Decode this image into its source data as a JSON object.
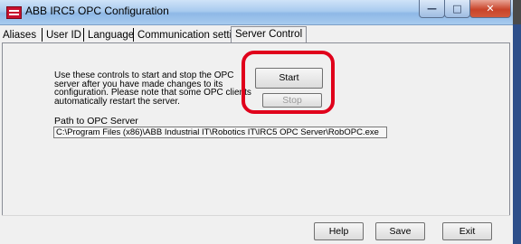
{
  "window": {
    "title": "ABB IRC5 OPC Configuration"
  },
  "tabs": [
    {
      "label": "Aliases"
    },
    {
      "label": "User ID"
    },
    {
      "label": "Language"
    },
    {
      "label": "Communication settings"
    },
    {
      "label": "Server Control",
      "selected": true
    }
  ],
  "server_control": {
    "description": "Use these controls to start and stop the OPC server after you have made changes to its configuration. Please note that some OPC clients automatically restart the server.",
    "start_label": "Start",
    "stop_label": "Stop",
    "path_label": "Path to OPC Server",
    "path_value": "C:\\Program Files (x86)\\ABB Industrial IT\\Robotics IT\\IRC5 OPC Server\\RobOPC.exe"
  },
  "footer": {
    "help_label": "Help",
    "save_label": "Save",
    "exit_label": "Exit"
  },
  "colors": {
    "highlight": "#e0001b",
    "close_button": "#c9442a"
  }
}
